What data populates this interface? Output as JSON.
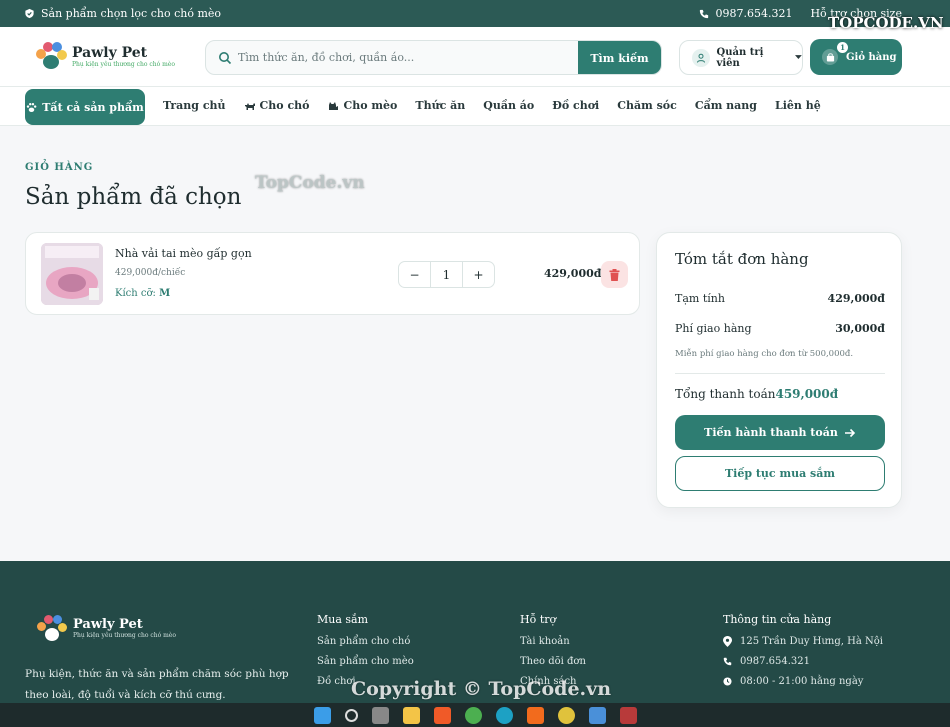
{
  "topbar": {
    "left_text": "Sản phẩm chọn lọc cho chó mèo",
    "phone": "0987.654.321",
    "size_help": "Hỗ trợ chọn size"
  },
  "brand": {
    "name": "Pawly Pet",
    "tagline": "Phụ kiện yêu thương cho chó mèo"
  },
  "search": {
    "placeholder": "Tìm thức ăn, đồ chơi, quần áo...",
    "button": "Tìm kiếm"
  },
  "account": {
    "label": "Quản trị viên"
  },
  "cart": {
    "label": "Giỏ hàng",
    "count": "1"
  },
  "nav": {
    "all_products": "Tất cả sản phẩm",
    "items": [
      "Trang chủ",
      "Cho chó",
      "Cho mèo",
      "Thức ăn",
      "Quần áo",
      "Đồ chơi",
      "Chăm sóc",
      "Cẩm nang",
      "Liên hệ"
    ]
  },
  "page": {
    "eyebrow": "GIỎ HÀNG",
    "title": "Sản phẩm đã chọn"
  },
  "cart_item": {
    "name": "Nhà vải tai mèo gấp gọn",
    "unit_price": "429,000đ/chiếc",
    "size_label": "Kích cỡ:",
    "size_value": "M",
    "quantity": "1",
    "minus": "−",
    "plus": "+",
    "line_total": "429,000đ"
  },
  "summary": {
    "title": "Tóm tắt đơn hàng",
    "subtotal_label": "Tạm tính",
    "subtotal_value": "429,000đ",
    "shipping_label": "Phí giao hàng",
    "shipping_value": "30,000đ",
    "note": "Miễn phí giao hàng cho đơn từ 500,000đ.",
    "total_label": "Tổng thanh toán",
    "total_value": "459,000đ",
    "checkout_button": "Tiến hành thanh toán",
    "continue_button": "Tiếp tục mua sắm"
  },
  "footer": {
    "brand_name": "Pawly Pet",
    "brand_tagline": "Phụ kiện yêu thương cho chó mèo",
    "description": "Phụ kiện, thức ăn và sản phẩm chăm sóc phù hợp theo loài, độ tuổi và kích cỡ thú cưng.",
    "shop": {
      "title": "Mua sắm",
      "links": [
        "Sản phẩm cho chó",
        "Sản phẩm cho mèo",
        "Đồ chơi"
      ]
    },
    "support": {
      "title": "Hỗ trợ",
      "links": [
        "Tài khoản",
        "Theo dõi đơn",
        "Chính sách"
      ]
    },
    "store": {
      "title": "Thông tin cửa hàng",
      "address": "125 Trần Duy Hưng, Hà Nội",
      "phone": "0987.654.321",
      "hours": "08:00 - 21:00 hằng ngày"
    }
  },
  "watermarks": {
    "top": "TopCode.vn",
    "corner": "TOPCODE.VN",
    "bottom": "Copyright © TopCode.vn"
  },
  "colors": {
    "primary": "#2e7d72",
    "topbar": "#2c5a55",
    "footer": "#244a47",
    "danger": "#e05252"
  }
}
